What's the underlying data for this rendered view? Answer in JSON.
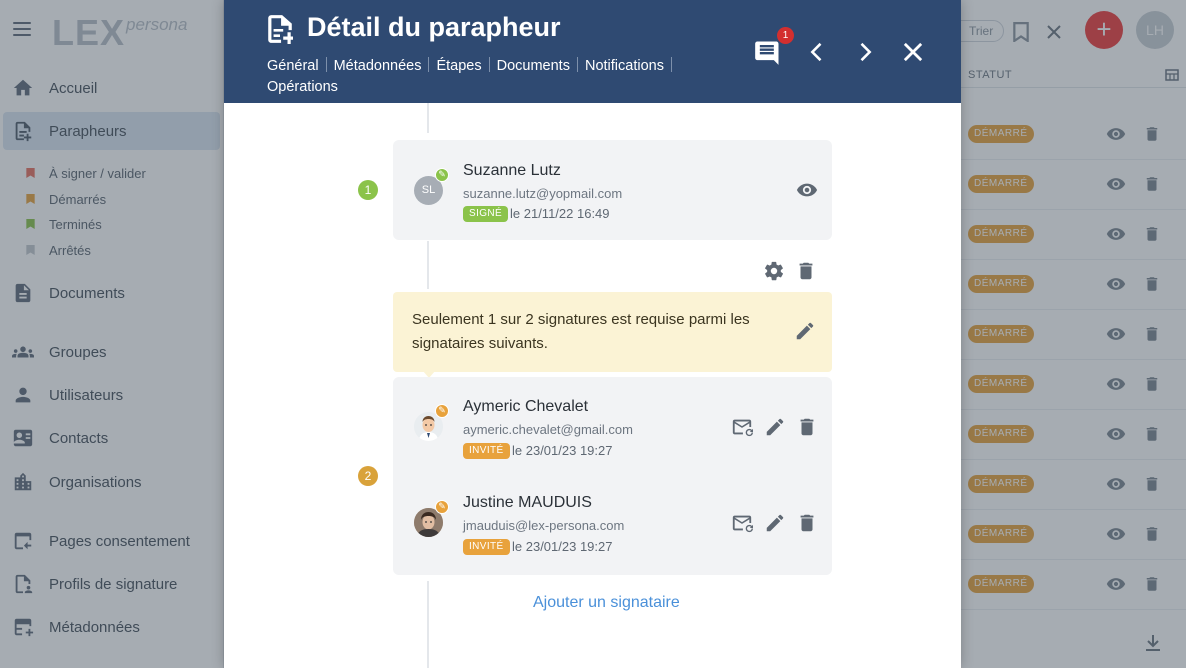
{
  "sidebar": {
    "logo_main": "LEX",
    "logo_sub": "persona",
    "items": [
      {
        "label": "Accueil"
      },
      {
        "label": "Parapheurs"
      },
      {
        "label": "Documents"
      },
      {
        "label": "Groupes"
      },
      {
        "label": "Utilisateurs"
      },
      {
        "label": "Contacts"
      },
      {
        "label": "Organisations"
      },
      {
        "label": "Pages consentement"
      },
      {
        "label": "Profils de signature"
      },
      {
        "label": "Métadonnées"
      }
    ],
    "sub_items": [
      {
        "label": "À signer / valider",
        "color": "#e8705f"
      },
      {
        "label": "Démarrés",
        "color": "#e8a23c"
      },
      {
        "label": "Terminés",
        "color": "#8bc34a"
      },
      {
        "label": "Arrêtés",
        "color": "#c3c8ce"
      }
    ]
  },
  "list": {
    "sort_label": "Trier",
    "user_initials": "LH",
    "column_header": "STATUT",
    "row_status": "DÉMARRÉ",
    "add_label": "+"
  },
  "modal": {
    "title": "Détail du parapheur",
    "tabs": [
      "Général",
      "Métadonnées",
      "Étapes",
      "Documents",
      "Notifications",
      "Opérations"
    ],
    "notification_count": "1",
    "steps": [
      {
        "number": "1",
        "signers": [
          {
            "initials": "SL",
            "name": "Suzanne Lutz",
            "email": "suzanne.lutz@yopmail.com",
            "status": "SIGNÉ",
            "date": "le 21/11/22 16:49"
          }
        ]
      },
      {
        "number": "2",
        "rule_text": "Seulement 1 sur 2 signatures est requise parmi les signataires suivants.",
        "signers": [
          {
            "name": "Aymeric Chevalet",
            "email": "aymeric.chevalet@gmail.com",
            "status": "INVITÉ",
            "date": "le 23/01/23 19:27"
          },
          {
            "name": "Justine MAUDUIS",
            "email": "jmauduis@lex-persona.com",
            "status": "INVITÉ",
            "date": "le 23/01/23 19:27"
          }
        ]
      }
    ],
    "add_signer_label": "Ajouter un signataire"
  },
  "colors": {
    "header_bg": "#2f4a72",
    "signed_green": "#8bc34a",
    "invited_orange": "#e8a23c",
    "note_bg": "#fbf3d5",
    "link_blue": "#4a90d9"
  }
}
